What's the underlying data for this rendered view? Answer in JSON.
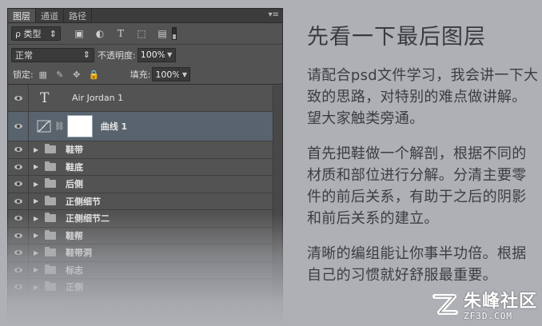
{
  "panel": {
    "tabs": [
      "图层",
      "通道",
      "路径"
    ],
    "filter": {
      "label": "ρ 类型"
    },
    "blend_mode": "正常",
    "opacity_label": "不透明度:",
    "opacity_value": "100%",
    "lock_label": "锁定:",
    "fill_label": "填充:",
    "fill_value": "100%",
    "layers": [
      {
        "kind": "text",
        "name": "Air Jordan 1"
      },
      {
        "kind": "curve",
        "name": "曲线 1"
      },
      {
        "kind": "group",
        "name": "鞋带"
      },
      {
        "kind": "group",
        "name": "鞋底"
      },
      {
        "kind": "group",
        "name": "后侧"
      },
      {
        "kind": "group",
        "name": "正侧细节"
      },
      {
        "kind": "group",
        "name": "正侧细节二"
      },
      {
        "kind": "group",
        "name": "鞋帮"
      },
      {
        "kind": "group",
        "name": "鞋带洞"
      },
      {
        "kind": "group",
        "name": "标志"
      },
      {
        "kind": "group",
        "name": "正侧"
      }
    ]
  },
  "article": {
    "title": "先看一下最后图层",
    "paragraphs": [
      "请配合psd文件学习，我会讲一下大致的思路，对特别的难点做讲解。望大家触类旁通。",
      "首先把鞋做一个解剖，根据不同的材质和部位进行分解。分清主要零件的前后关系，有助于之后的阴影和前后关系的建立。",
      "清晰的编组能让你事半功倍。根据自己的习惯就好舒服最重要。"
    ]
  },
  "watermark": {
    "cn": "朱峰社区",
    "en": "ZF3D.COM"
  }
}
